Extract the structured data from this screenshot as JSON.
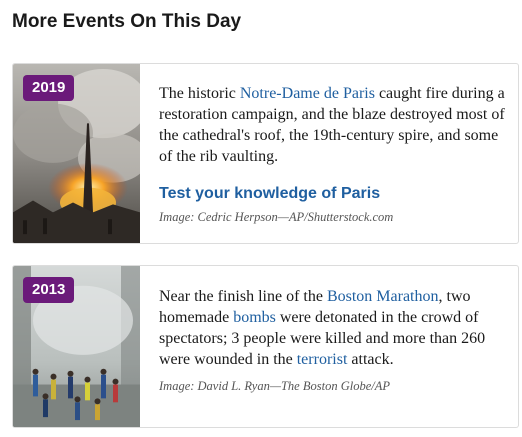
{
  "section": {
    "title": "More Events On This Day"
  },
  "events": [
    {
      "year": "2019",
      "desc_1": "The historic ",
      "link_1": "Notre-Dame de Paris",
      "desc_2": " caught fire during a restoration campaign, and the blaze destroyed most of the cathedral's roof, the 19th-century spire, and some of the rib vaulting.",
      "quiz_link": "Test your knowledge of Paris",
      "credit": "Image: Cedric Herpson—AP/Shutterstock.com"
    },
    {
      "year": "2013",
      "desc_1": "Near the finish line of the ",
      "link_1": "Boston Marathon",
      "desc_2": ", two homemade ",
      "link_2": "bombs",
      "desc_3": " were detonated in the crowd of spectators; 3 people were killed and more than 260 were wounded in the ",
      "link_3": "terrorist",
      "desc_4": " attack.",
      "credit": "Image: David L. Ryan—The Boston Globe/AP"
    }
  ],
  "colors": {
    "badge": "#6b1a7a",
    "link": "#1f5fa0"
  }
}
